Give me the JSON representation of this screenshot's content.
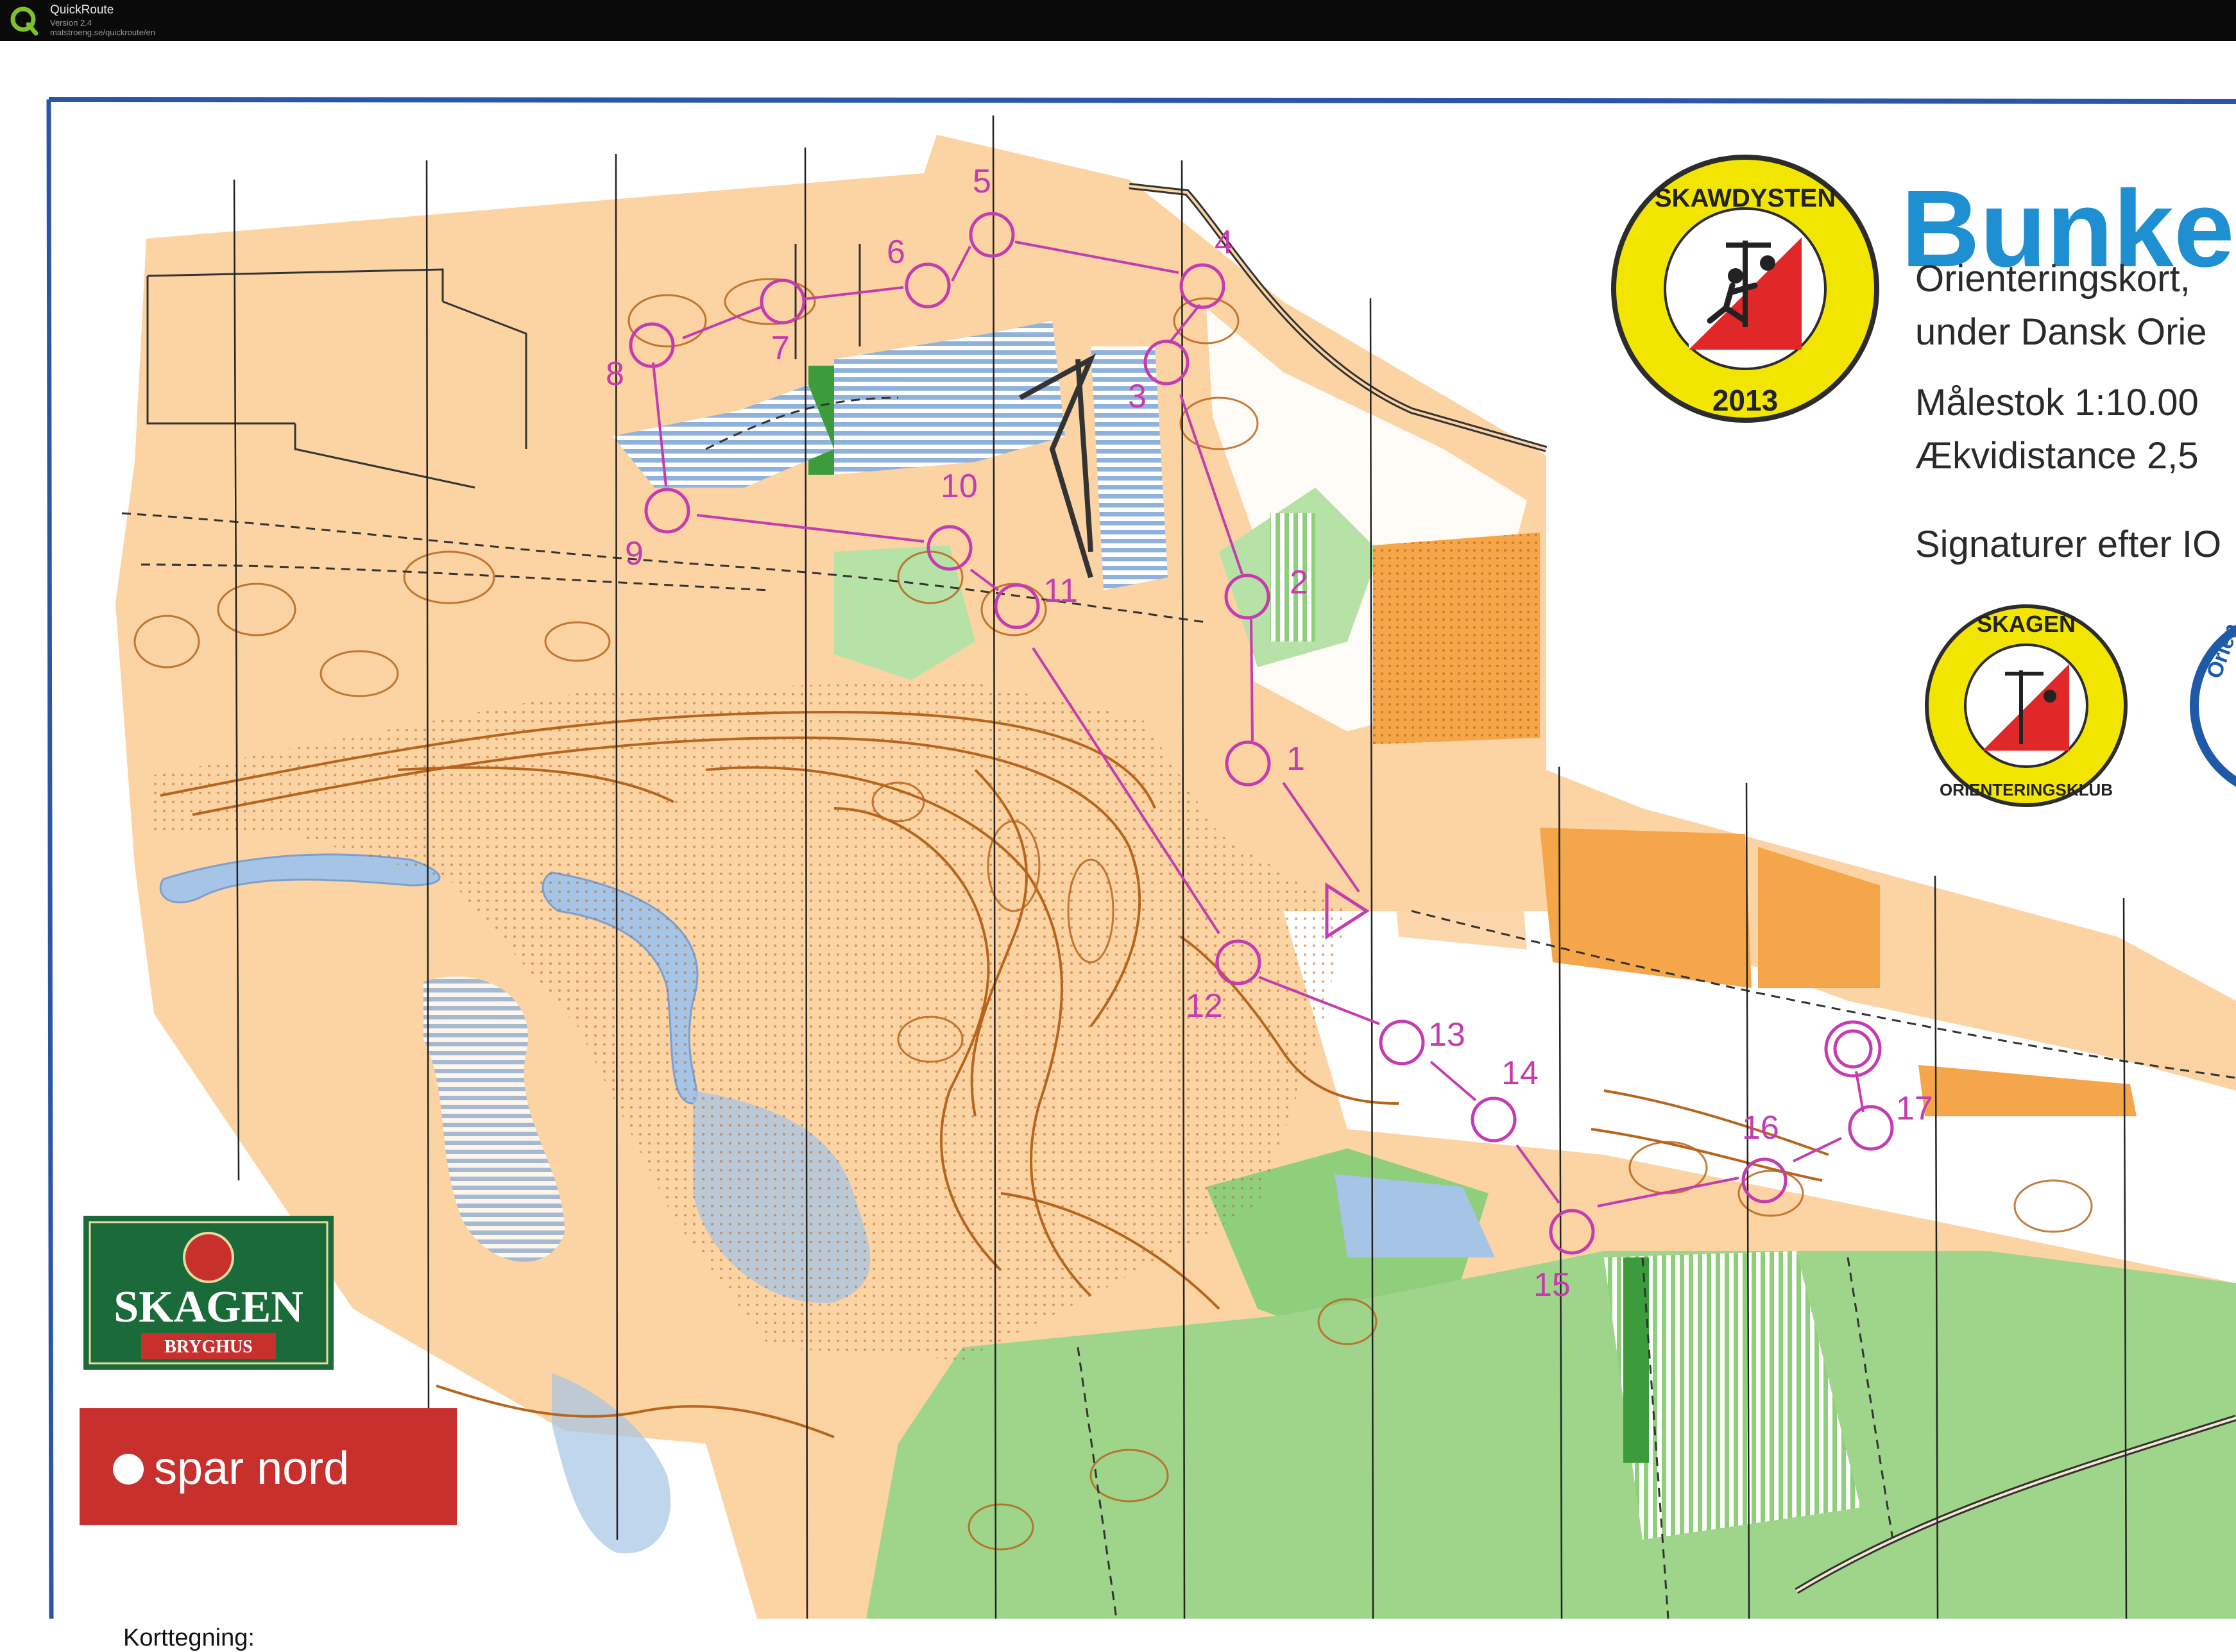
{
  "window": {
    "app_title": "QuickRoute",
    "version": "Version 2.4",
    "url": "matstroeng.se/quickroute/en"
  },
  "map": {
    "title": "Bunke",
    "info_lines": [
      "Orienteringskort,",
      "under Dansk Orie",
      "Målestok 1:10.00",
      "Ækvidistance 2,5",
      "Signaturer efter IO"
    ],
    "mapper_label": "Korttegning:",
    "controls": [
      "1",
      "2",
      "3",
      "4",
      "5",
      "6",
      "7",
      "8",
      "9",
      "10",
      "11",
      "12",
      "13",
      "14",
      "15",
      "16",
      "17"
    ],
    "colors": {
      "open_land": "#fcd3a3",
      "forest": "#ffffff",
      "green": "#8fce7a",
      "dark_green": "#3c9c3c",
      "water": "#a5c4e6",
      "contour": "#b7651d",
      "course": "#c43caf",
      "cultivated": "#f5a64a",
      "border": "#2b56a8"
    }
  },
  "logos": {
    "event_top": "SKAWDYSTEN",
    "event_year": "2013",
    "club_top": "SKAGEN",
    "club_bottom": "ORIENTERINGSKLUB",
    "partial_logo": "Orien",
    "sponsor1": "SKAGEN",
    "sponsor1_sub": "BRYGHUS",
    "sponsor2": "spar nord"
  }
}
